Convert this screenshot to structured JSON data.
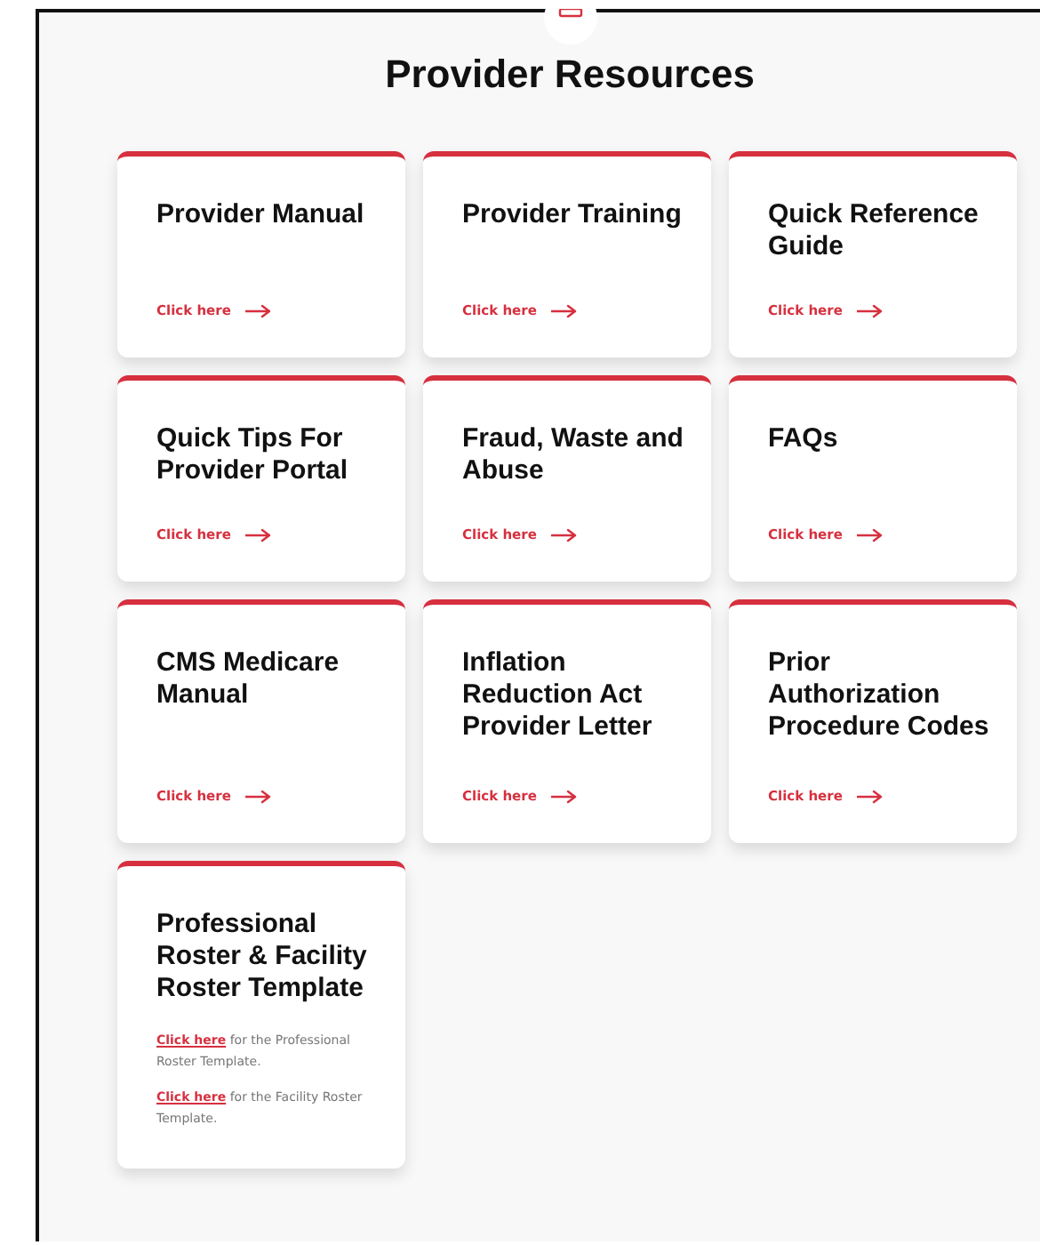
{
  "title": "Provider Resources",
  "cards": [
    {
      "kind": "link",
      "title": "Provider Manual",
      "link": "Click here"
    },
    {
      "kind": "link",
      "title": "Provider Training",
      "link": "Click here"
    },
    {
      "kind": "link",
      "title": "Quick Reference Guide",
      "link": "Click here"
    },
    {
      "kind": "link",
      "title": "Quick Tips For Provider Portal",
      "link": "Click here"
    },
    {
      "kind": "link",
      "title": "Fraud, Waste and Abuse",
      "link": "Click here"
    },
    {
      "kind": "link",
      "title": "FAQs",
      "link": "Click here"
    },
    {
      "kind": "link",
      "title": "CMS Medicare Manual",
      "link": "Click here"
    },
    {
      "kind": "link",
      "title": "Inflation Reduction Act Provider Letter",
      "link": "Click here"
    },
    {
      "kind": "link",
      "title": "Prior Authorization Procedure Codes",
      "link": "Click here"
    },
    {
      "kind": "notes",
      "title": "Professional Roster & Facility Roster Template",
      "notes": [
        {
          "link": "Click here",
          "text": "for the Professional Roster Template."
        },
        {
          "link": "Click here",
          "text": "for the Facility Roster Template."
        }
      ]
    }
  ]
}
